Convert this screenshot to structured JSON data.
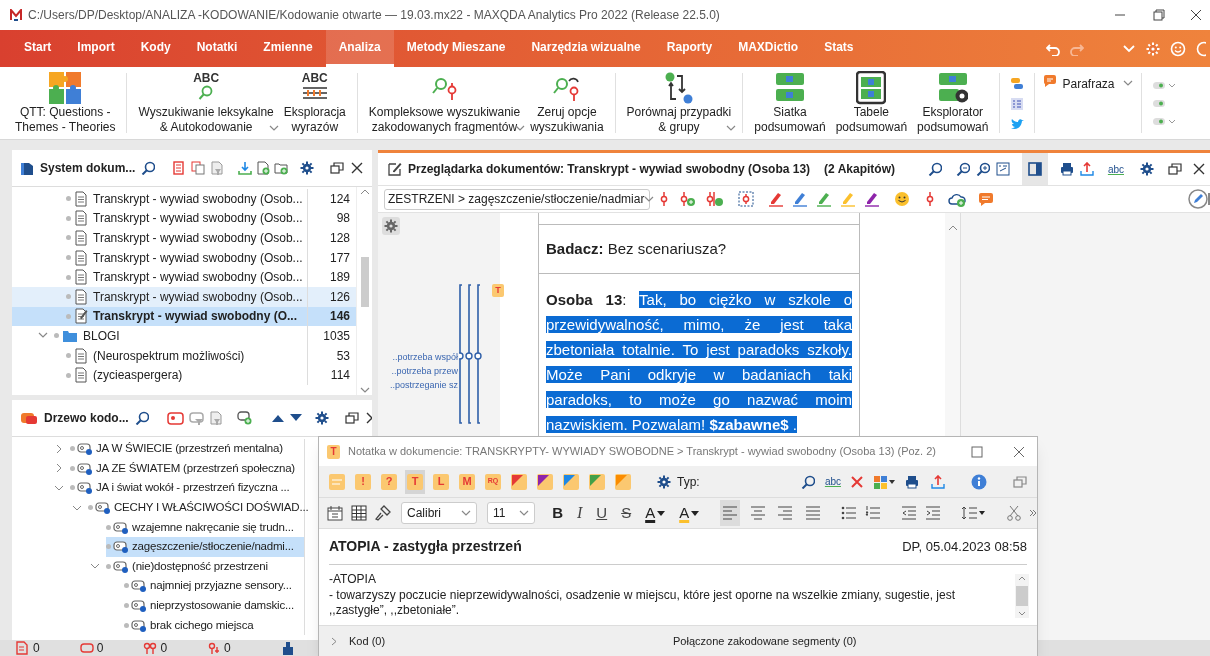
{
  "window": {
    "title": "C:/Users/DP/Desktop/ANALIZA -KODOWANIE/Kodowanie otwarte — 19.03.mx22 - MAXQDA Analytics Pro 2022 (Release 22.5.0)"
  },
  "menu": [
    {
      "label": "Start",
      "selected": false
    },
    {
      "label": "Import",
      "selected": false
    },
    {
      "label": "Kody",
      "selected": false
    },
    {
      "label": "Notatki",
      "selected": false
    },
    {
      "label": "Zmienne",
      "selected": false
    },
    {
      "label": "Analiza",
      "selected": true
    },
    {
      "label": "Metody Mieszane",
      "selected": false
    },
    {
      "label": "Narzędzia wizualne",
      "selected": false
    },
    {
      "label": "Raporty",
      "selected": false
    },
    {
      "label": "MAXDictio",
      "selected": false
    },
    {
      "label": "Stats",
      "selected": false
    }
  ],
  "ribbon": {
    "groups": [
      {
        "items": [
          {
            "kind": "puzzle",
            "lines": [
              "QTT: Questions -",
              "Themes - Theories"
            ],
            "dropdown": false
          }
        ]
      },
      {
        "items": [
          {
            "kind": "abc_search",
            "icon_text": "ABC",
            "lines": [
              "Wyszukiwanie leksykalne",
              "& Autokodowanie"
            ],
            "dropdown": true
          },
          {
            "kind": "abc_bars",
            "icon_text": "ABC",
            "lines": [
              "Eksploracja",
              "wyrazów"
            ],
            "dropdown": false
          }
        ]
      },
      {
        "items": [
          {
            "kind": "search_code",
            "lines": [
              "Kompleksowe wyszukiwanie",
              "zakodowanych fragmentów"
            ],
            "dropdown": true
          },
          {
            "kind": "reset",
            "lines": [
              "Zeruj opcje",
              "wyszukiwania"
            ],
            "dropdown": false
          }
        ]
      },
      {
        "items": [
          {
            "kind": "compare",
            "lines": [
              "Porównaj przypadki",
              "& grupy"
            ],
            "dropdown": true
          }
        ]
      },
      {
        "items": [
          {
            "kind": "grid",
            "lines": [
              "Siatka",
              "podsumowań"
            ],
            "dropdown": false
          },
          {
            "kind": "table",
            "lines": [
              "Tabele",
              "podsumowań"
            ],
            "dropdown": false
          },
          {
            "kind": "explorer",
            "lines": [
              "Eksplorator",
              "podsumowań"
            ],
            "dropdown": false
          }
        ]
      }
    ],
    "paraphrase": "Parafraza"
  },
  "document_system": {
    "title": "System dokum...",
    "items": [
      {
        "kind": "document",
        "label": "Transkrypt - wywiad swobodny (Osob...",
        "count": "124",
        "selected": false,
        "highlighted": false
      },
      {
        "kind": "document",
        "label": "Transkrypt - wywiad swobodny (Osob...",
        "count": "98",
        "selected": false,
        "highlighted": false
      },
      {
        "kind": "document",
        "label": "Transkrypt - wywiad swobodny (Osob...",
        "count": "128",
        "selected": false,
        "highlighted": false
      },
      {
        "kind": "document",
        "label": "Transkrypt - wywiad swobodny (Osob...",
        "count": "177",
        "selected": false,
        "highlighted": false
      },
      {
        "kind": "document",
        "label": "Transkrypt - wywiad swobodny (Osob...",
        "count": "189",
        "selected": false,
        "highlighted": false
      },
      {
        "kind": "document",
        "label": "Transkrypt - wywiad swobodny (Osob...",
        "count": "126",
        "selected": false,
        "highlighted": true
      },
      {
        "kind": "open_document",
        "label": "Transkrypt - wywiad swobodny (O...",
        "count": "146",
        "selected": true,
        "highlighted": false
      },
      {
        "kind": "folder",
        "label": "BLOGI",
        "count": "1035",
        "selected": false,
        "highlighted": false,
        "expanded": true,
        "children": [
          {
            "kind": "document",
            "label": "(Neurospektrum możliwości)",
            "count": "53",
            "selected": false,
            "highlighted": false
          },
          {
            "kind": "document",
            "label": "(zycieaspergera)",
            "count": "114",
            "selected": false,
            "highlighted": false
          }
        ]
      }
    ]
  },
  "code_system": {
    "title": "Drzewo kodo...",
    "items": [
      {
        "label": "JA  W ŚWIECIE (przestrzeń mentalna)",
        "expanded": false,
        "selected": false,
        "has_children": true
      },
      {
        "label": "JA ZE ŚWIATEM (przestrzeń społeczna)",
        "expanded": false,
        "selected": false,
        "has_children": true
      },
      {
        "label": "JA i świat wokół - przestrzeń fizyczna ...",
        "expanded": true,
        "selected": false,
        "has_children": true,
        "children": [
          {
            "label": "CECHY I WŁAŚCIWOŚCI DOŚWIAD...",
            "expanded": true,
            "selected": false,
            "has_children": true,
            "children": [
              {
                "label": "wzajemne nakręcanie się trudn...",
                "selected": false,
                "has_children": false
              },
              {
                "label": "zagęszczenie/stłoczenie/nadmi...",
                "selected": true,
                "has_children": false
              },
              {
                "label": "(nie)dostępność przestrzeni",
                "expanded": true,
                "selected": false,
                "has_children": true,
                "children": [
                  {
                    "label": "najmniej przyjazne sensory...",
                    "selected": false,
                    "has_children": false
                  },
                  {
                    "label": "nieprzystosowanie damskic...",
                    "selected": false,
                    "has_children": false
                  },
                  {
                    "label": "brak cichego miejsca",
                    "selected": false,
                    "has_children": false
                  }
                ]
              }
            ]
          }
        ]
      }
    ]
  },
  "status_bar": {
    "counts": [
      {
        "kind": "document",
        "value": "0"
      },
      {
        "kind": "code",
        "value": "0"
      },
      {
        "kind": "segments",
        "value": "0"
      },
      {
        "kind": "weight",
        "value": "0"
      }
    ]
  },
  "browser": {
    "title": "Przeglądarka dokumentów: Transkrypt - wywiad swobodny (Osoba 13)",
    "paragraph_count": "(2 Akapitów)",
    "spellcheck": "abc",
    "active_code": "ZESTRZENI > zagęszczenie/stłoczenie/nadmiar",
    "stripes": [
      "..potrzeba współ",
      "..potrzeba przew",
      "..postrzeganie sz"
    ],
    "memo": "T",
    "paragraphs": [
      {
        "speaker": "**Badacz:**",
        "text": "Bez scenariusza?",
        "selected": false
      },
      {
        "speaker": "**Osoba  13**:",
        "text": "Tak, bo ciężko w szkole o przewidywalność, mimo, że jest taka zbetoniała totalnie. To jest paradoks szkoły. Może Pani odkryje w badaniach taki paradoks, to może go nazwać moim nazwiskiem. Pozwalam! **$zabawne$** .",
        "selected": true
      }
    ]
  },
  "note": {
    "title": "Notatka w dokumencie: TRANSKRYPTY- WYWIADY SWOBODNE > Transkrypt - wywiad swobodny (Osoba 13) (Poz. 2)",
    "icon": "T",
    "types": [
      {
        "kind": "lines",
        "selected": false
      },
      {
        "kind": "letter",
        "label": "!",
        "selected": false
      },
      {
        "kind": "letter",
        "label": "?",
        "selected": false
      },
      {
        "kind": "letter",
        "label": "T",
        "selected": true
      },
      {
        "kind": "letter",
        "label": "L",
        "selected": false
      },
      {
        "kind": "letter",
        "label": "M",
        "selected": false
      },
      {
        "kind": "letter",
        "label": "RQ",
        "selected": false
      },
      {
        "kind": "flag",
        "color": "#e53935",
        "selected": false
      },
      {
        "kind": "flag",
        "color": "#8e24aa",
        "selected": false
      },
      {
        "kind": "flag",
        "color": "#1e88e5",
        "selected": false
      },
      {
        "kind": "flag",
        "color": "#43a047",
        "selected": false
      },
      {
        "kind": "flag",
        "color": "#fb8c00",
        "selected": false
      }
    ],
    "type_label": "Typ:",
    "spellcheck": "abc",
    "font": "Calibri",
    "size": "11",
    "format": [
      {
        "kind": "bold",
        "label": "B"
      },
      {
        "kind": "italic",
        "label": "I"
      },
      {
        "kind": "underline",
        "label": "U"
      },
      {
        "kind": "strike",
        "label": "S"
      },
      {
        "kind": "font_color",
        "label": "A"
      },
      {
        "kind": "highlight",
        "label": "A"
      }
    ],
    "align": [
      {
        "kind": "left",
        "selected": true
      },
      {
        "kind": "center",
        "selected": false
      },
      {
        "kind": "right",
        "selected": false
      },
      {
        "kind": "justify",
        "selected": false
      }
    ],
    "memo_title": "ATOPIA - zastygła przestrzeń",
    "author_date": "DP, 05.04.2023 08:58",
    "body": [
      "-ATOPIA",
      "- towarzyszy poczucie nieprzewidywalności, osadzenie w miejscu, które jest oporne na wszelkie zmiany, sugestie, jest ,,zastygłe”, ,,zbetoniałe”."
    ],
    "footer": [
      "Kod (0)",
      "Połączone zakodowane segmenty (0)"
    ]
  }
}
